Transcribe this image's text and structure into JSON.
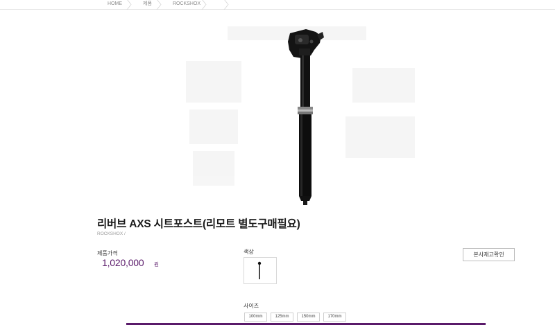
{
  "breadcrumb": {
    "items": [
      "HOME",
      "제품",
      "ROCKSHOX",
      ""
    ]
  },
  "product": {
    "image_alt": "Reverb AXS seatpost product photo",
    "title": "리버브 AXS 시트포스트(리모트 별도구매필요)",
    "brand_path": "ROCKSHOX /",
    "price_label": "제품가격",
    "price_value": "1,020,000",
    "price_unit": "원",
    "color_label": "색상",
    "size_label": "사이즈",
    "sizes": [
      "100mm",
      "125mm",
      "150mm",
      "170mm"
    ],
    "stock_button_label": "본사재고확인"
  },
  "colors": {
    "accent": "#5a1a6a",
    "border": "#cfcfcf"
  }
}
